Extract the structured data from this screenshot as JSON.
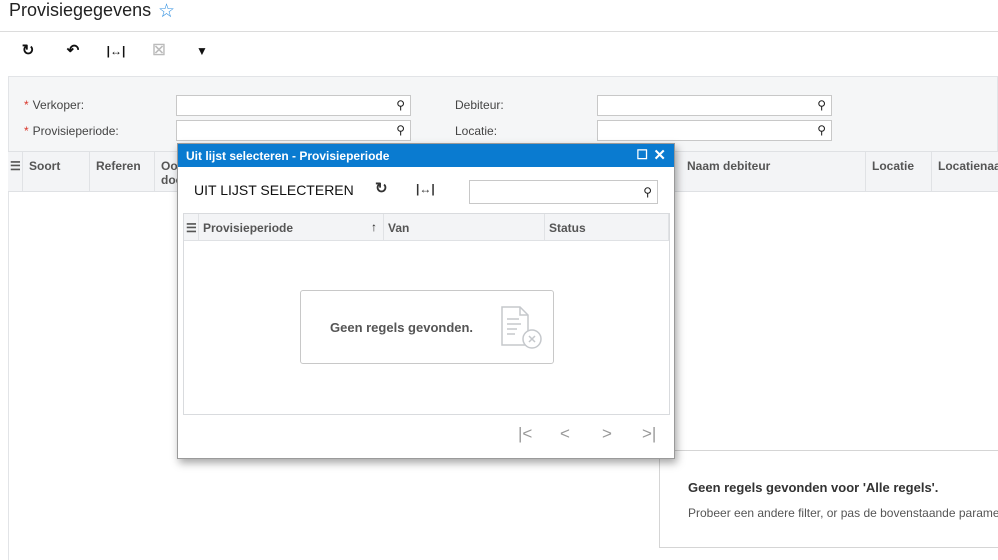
{
  "header": {
    "title": "Provisiegegevens"
  },
  "toolbar": {
    "refresh": "↻",
    "undo": "↶",
    "fit": "|↔|",
    "export": "☒",
    "filter": "▼"
  },
  "form": {
    "verkoper_label": "Verkoper:",
    "periode_label": "Provisieperiode:",
    "debiteur_label": "Debiteur:",
    "locatie_label": "Locatie:",
    "required_mark": "*"
  },
  "grid": {
    "columns": [
      "Soort",
      "Referen",
      "Oor doc",
      "Naam debiteur",
      "Locatie",
      "Locatienaa"
    ]
  },
  "empty_main": {
    "title": "Geen regels gevonden voor 'Alle regels'.",
    "subtitle": "Probeer een andere filter, or pas de bovenstaande parame"
  },
  "dialog": {
    "title": "Uit lijst selecteren - Provisieperiode",
    "toolbar_label": "UIT LIJST SELECTEREN",
    "search_value": "",
    "columns": [
      "Provisieperiode",
      "Van",
      "Status"
    ],
    "sort_indicator": "↑",
    "empty": "Geen regels gevonden."
  }
}
